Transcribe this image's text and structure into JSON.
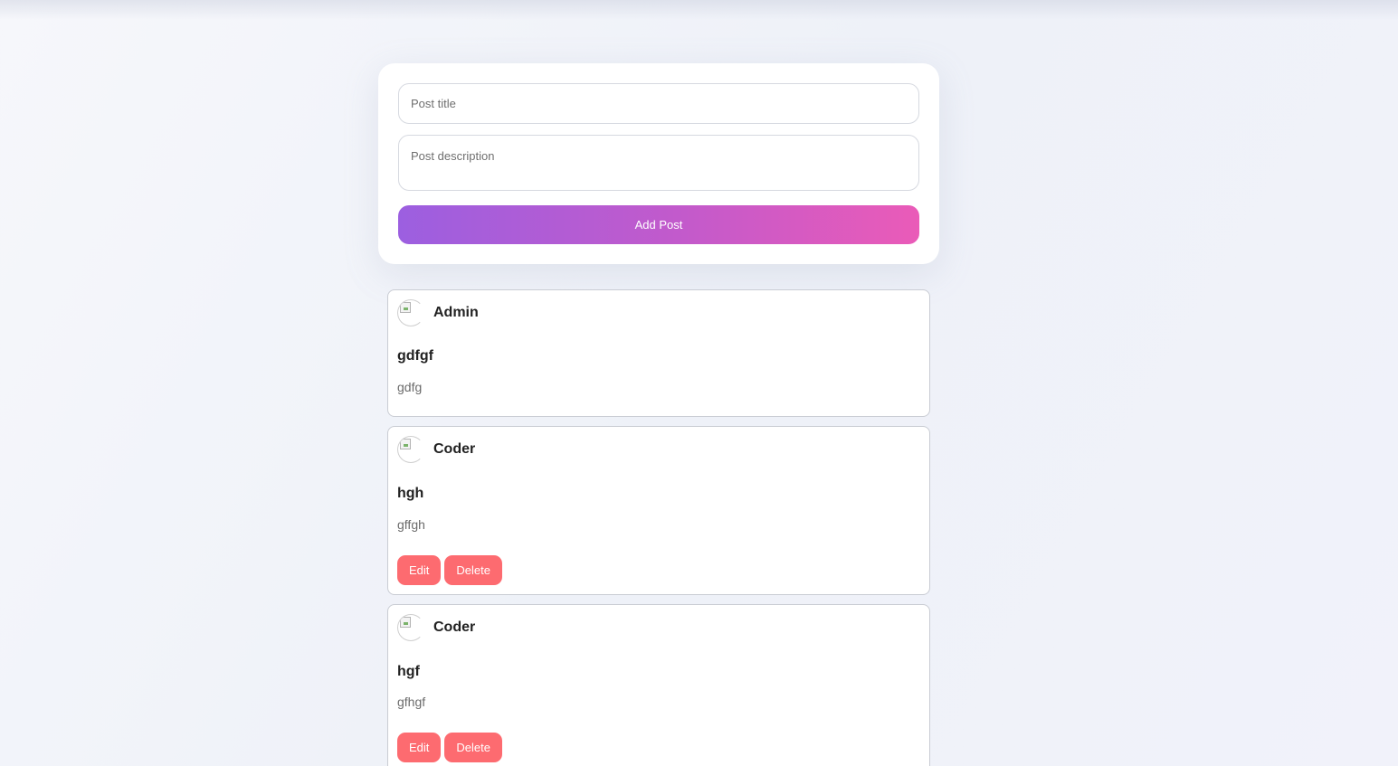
{
  "composer": {
    "title_placeholder": "Post title",
    "description_placeholder": "Post description",
    "add_button_label": "Add Post"
  },
  "posts": [
    {
      "author": "Admin",
      "title": "gdfgf",
      "description": "gdfg",
      "has_actions": false
    },
    {
      "author": "Coder",
      "title": "hgh",
      "description": "gffgh",
      "has_actions": true,
      "edit_label": "Edit",
      "delete_label": "Delete"
    },
    {
      "author": "Coder",
      "title": "hgf",
      "description": "gfhgf",
      "has_actions": true,
      "edit_label": "Edit",
      "delete_label": "Delete"
    }
  ],
  "colors": {
    "accent_gradient_start": "#9c5fe0",
    "accent_gradient_end": "#ea5bb8",
    "action_button": "#fd6b70"
  }
}
